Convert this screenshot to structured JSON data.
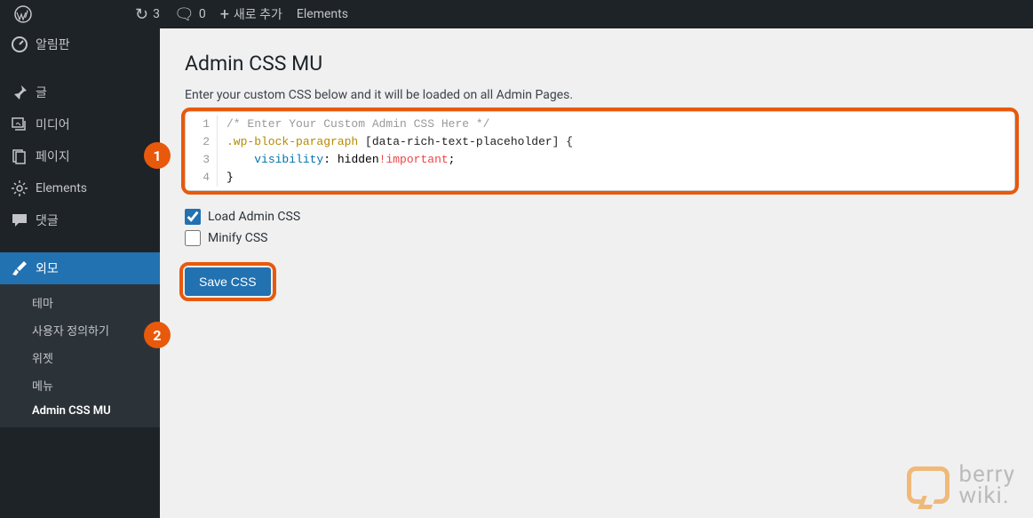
{
  "toolbar": {
    "updates_count": "3",
    "comments_count": "0",
    "new_label": "새로 추가",
    "elements_label": "Elements"
  },
  "sidebar": {
    "items": [
      {
        "label": "알림판",
        "icon": "dashboard"
      },
      {
        "label": "글",
        "icon": "pin"
      },
      {
        "label": "미디어",
        "icon": "media"
      },
      {
        "label": "페이지",
        "icon": "page"
      },
      {
        "label": "Elements",
        "icon": "gear"
      },
      {
        "label": "댓글",
        "icon": "comment"
      },
      {
        "label": "외모",
        "icon": "brush"
      }
    ],
    "submenu": [
      {
        "label": "테마"
      },
      {
        "label": "사용자 정의하기"
      },
      {
        "label": "위젯"
      },
      {
        "label": "메뉴"
      },
      {
        "label": "Admin CSS MU"
      }
    ]
  },
  "main": {
    "title": "Admin CSS MU",
    "description": "Enter your custom CSS below and it will be loaded on all Admin Pages.",
    "code": {
      "line1_comment": "/* Enter Your Custom Admin CSS Here */",
      "line2_selector_class": ".wp-block-paragraph",
      "line2_selector_attr": " [data-rich-text-placeholder] {",
      "line3_indent": "    ",
      "line3_prop": "visibility",
      "line3_colon": ": ",
      "line3_val": "hidden",
      "line3_imp": "!important",
      "line3_semi": ";",
      "line4": "}",
      "gutter": [
        "1",
        "2",
        "3",
        "4"
      ]
    },
    "checkbox_load": "Load Admin CSS",
    "checkbox_minify": "Minify CSS",
    "save_button": "Save CSS"
  },
  "badges": {
    "one": "1",
    "two": "2"
  },
  "watermark": {
    "line1": "berry",
    "line2": "wiki."
  }
}
